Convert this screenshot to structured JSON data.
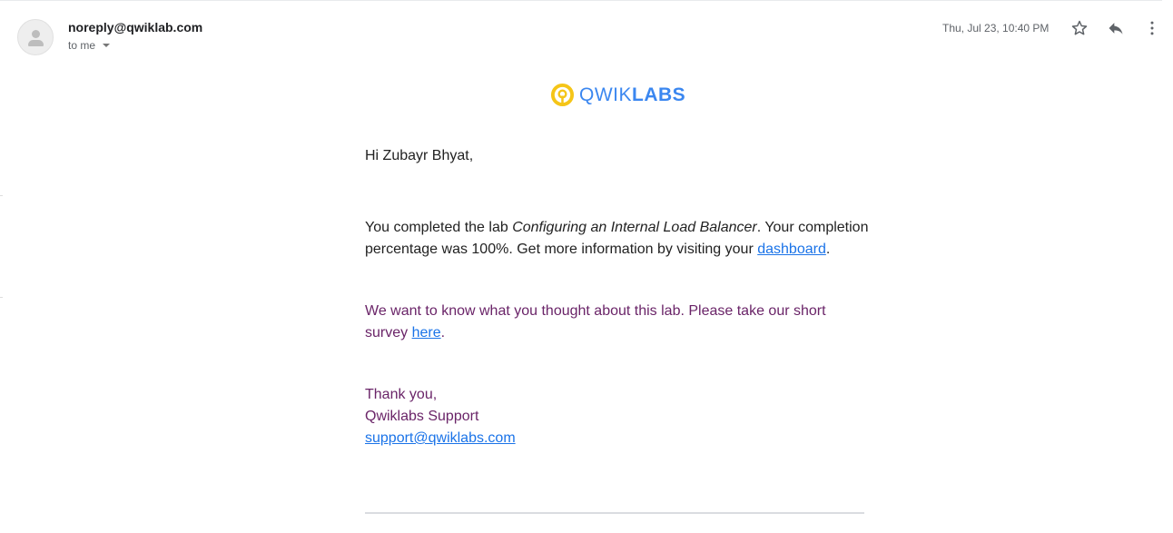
{
  "header": {
    "sender": "noreply@qwiklab.com",
    "recipient_label": "to me",
    "date": "Thu, Jul 23, 10:40 PM",
    "icons": [
      "person-avatar-icon",
      "star-icon",
      "reply-icon",
      "more-vert-icon"
    ]
  },
  "logo": {
    "light": "QWIK",
    "bold": "LABS",
    "brand_blue": "#3b87f0",
    "brand_yellow": "#f5c518"
  },
  "body": {
    "greeting": "Hi Zubayr Bhyat,",
    "completion_prefix": "You completed the lab ",
    "lab_name": "Configuring an Internal Load Balancer",
    "completion_suffix": ". Your completion percentage was 100%. Get more information by visiting your ",
    "dashboard_link": "dashboard",
    "period": ".",
    "survey_text": "We want to know what you thought about this lab. Please take our short survey ",
    "survey_link": "here",
    "thanks": "Thank you,",
    "signature": "Qwiklabs Support",
    "support_email": "support@qwiklabs.com"
  }
}
